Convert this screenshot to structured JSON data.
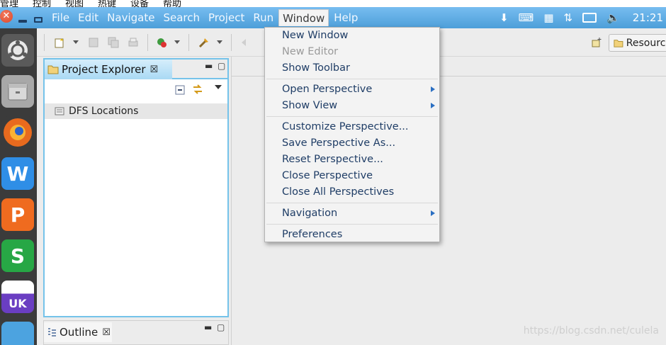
{
  "host_menu": {
    "items": [
      "管理",
      "控制",
      "视图",
      "热键",
      "设备",
      "帮助"
    ]
  },
  "menubar": {
    "items": [
      {
        "label": "File"
      },
      {
        "label": "Edit"
      },
      {
        "label": "Navigate"
      },
      {
        "label": "Search"
      },
      {
        "label": "Project"
      },
      {
        "label": "Run"
      },
      {
        "label": "Window",
        "active": true
      },
      {
        "label": "Help"
      }
    ]
  },
  "panel": {
    "clock": "21:21",
    "indicator_icons": [
      "download-icon",
      "keyboard-icon",
      "calendar-icon",
      "network-icon",
      "battery-icon",
      "volume-icon"
    ]
  },
  "launcher": {
    "items": [
      {
        "name": "ubuntu-dash-icon",
        "color": "#5a5a5a"
      },
      {
        "name": "files-icon",
        "color": "#a8a8a8"
      },
      {
        "name": "firefox-icon",
        "color": "#e25b1e"
      },
      {
        "name": "wps-writer-icon",
        "glyph": "W",
        "color": "#2f8ee6"
      },
      {
        "name": "wps-presentation-icon",
        "glyph": "P",
        "color": "#ef6b1f"
      },
      {
        "name": "wps-spreadsheets-icon",
        "glyph": "S",
        "color": "#27a745"
      },
      {
        "name": "ubuntukylin-icon",
        "glyph": "UK",
        "color": "#6a3ec2"
      },
      {
        "name": "software-center-icon",
        "color": "#4ca3e0"
      }
    ]
  },
  "toolbar": {
    "resource_label": "Resource"
  },
  "explorer": {
    "tab_title": "Project Explorer",
    "tab_close": "☒",
    "tree": [
      {
        "label": "DFS Locations"
      }
    ]
  },
  "outline": {
    "tab_title": "Outline",
    "tab_close": "☒"
  },
  "window_menu": {
    "groups": [
      [
        {
          "label": "New Window"
        },
        {
          "label": "New Editor",
          "disabled": true
        },
        {
          "label": "Show Toolbar"
        }
      ],
      [
        {
          "label": "Open Perspective",
          "submenu": true
        },
        {
          "label": "Show View",
          "submenu": true
        }
      ],
      [
        {
          "label": "Customize Perspective..."
        },
        {
          "label": "Save Perspective As..."
        },
        {
          "label": "Reset Perspective..."
        },
        {
          "label": "Close Perspective"
        },
        {
          "label": "Close All Perspectives"
        }
      ],
      [
        {
          "label": "Navigation",
          "submenu": true
        }
      ],
      [
        {
          "label": "Preferences"
        }
      ]
    ]
  },
  "watermark": "https://blog.csdn.net/culela",
  "colors": {
    "panel_blue": "#5aa9e0",
    "accent_border": "#75c3ea",
    "menu_text": "#1f3d66"
  }
}
